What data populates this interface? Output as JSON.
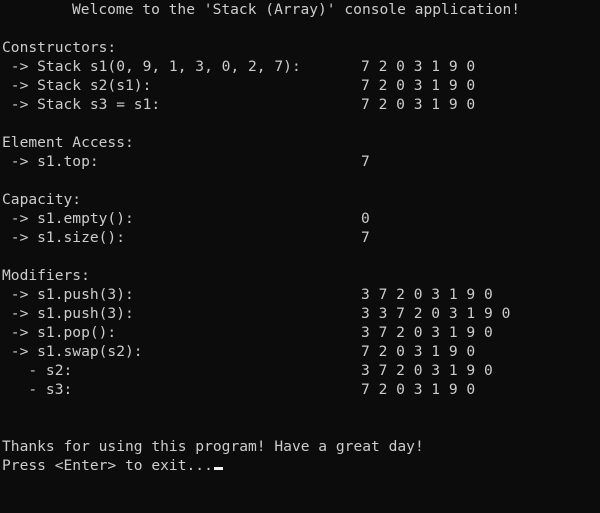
{
  "console": {
    "title": "Welcome to the 'Stack (Array)' console application!",
    "sections": {
      "constructors": {
        "heading": "Constructors:",
        "rows": [
          {
            "label": " -> Stack s1(0, 9, 1, 3, 0, 2, 7):",
            "value": "7 2 0 3 1 9 0"
          },
          {
            "label": " -> Stack s2(s1):",
            "value": "7 2 0 3 1 9 0"
          },
          {
            "label": " -> Stack s3 = s1:",
            "value": "7 2 0 3 1 9 0"
          }
        ]
      },
      "element_access": {
        "heading": "Element Access:",
        "rows": [
          {
            "label": " -> s1.top:",
            "value": "7"
          }
        ]
      },
      "capacity": {
        "heading": "Capacity:",
        "rows": [
          {
            "label": " -> s1.empty():",
            "value": "0"
          },
          {
            "label": " -> s1.size():",
            "value": "7"
          }
        ]
      },
      "modifiers": {
        "heading": "Modifiers:",
        "rows": [
          {
            "label": " -> s1.push(3):",
            "value": "3 7 2 0 3 1 9 0"
          },
          {
            "label": " -> s1.push(3):",
            "value": "3 3 7 2 0 3 1 9 0"
          },
          {
            "label": " -> s1.pop():",
            "value": "3 7 2 0 3 1 9 0"
          },
          {
            "label": " -> s1.swap(s2):",
            "value": "7 2 0 3 1 9 0"
          },
          {
            "label": "   - s2:",
            "value": "3 7 2 0 3 1 9 0"
          },
          {
            "label": "   - s3:",
            "value": "7 2 0 3 1 9 0"
          }
        ]
      }
    },
    "goodbye": "Thanks for using this program! Have a great day!",
    "prompt": "Press <Enter> to exit..."
  },
  "colors": {
    "background": "#0c0c0c",
    "text": "#cccccc",
    "cursor": "#f2f2f2"
  }
}
